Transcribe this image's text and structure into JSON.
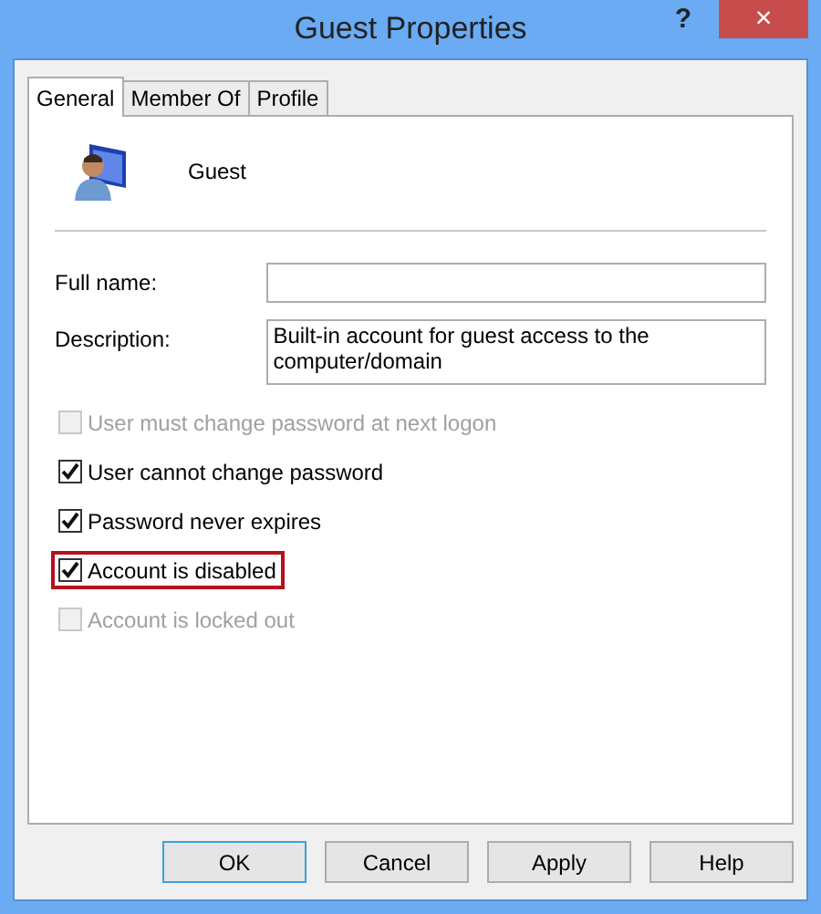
{
  "window": {
    "title": "Guest Properties",
    "help": "?",
    "close": "×"
  },
  "tabs": [
    {
      "label": "General",
      "selected": true
    },
    {
      "label": "Member Of",
      "selected": false
    },
    {
      "label": "Profile",
      "selected": false
    }
  ],
  "user": {
    "name": "Guest"
  },
  "fields": [
    {
      "label": "Full name:"
    },
    {
      "label": "Description:",
      "value": "Built-in account for guest access to the computer/domain"
    }
  ],
  "options": [
    {
      "label": "User must change password at next logon",
      "checked": false,
      "disabled": true,
      "highlighted": false
    },
    {
      "label": "User cannot change password",
      "checked": true,
      "disabled": false,
      "highlighted": false
    },
    {
      "label": "Password never expires",
      "checked": true,
      "disabled": false,
      "highlighted": false
    },
    {
      "label": "Account is disabled",
      "checked": true,
      "disabled": false,
      "highlighted": true
    },
    {
      "label": "Account is locked out",
      "checked": false,
      "disabled": true,
      "highlighted": false
    }
  ],
  "buttons": [
    {
      "label": "OK",
      "default": true
    },
    {
      "label": "Cancel",
      "default": false
    },
    {
      "label": "Apply",
      "default": false
    },
    {
      "label": "Help",
      "default": false
    }
  ]
}
